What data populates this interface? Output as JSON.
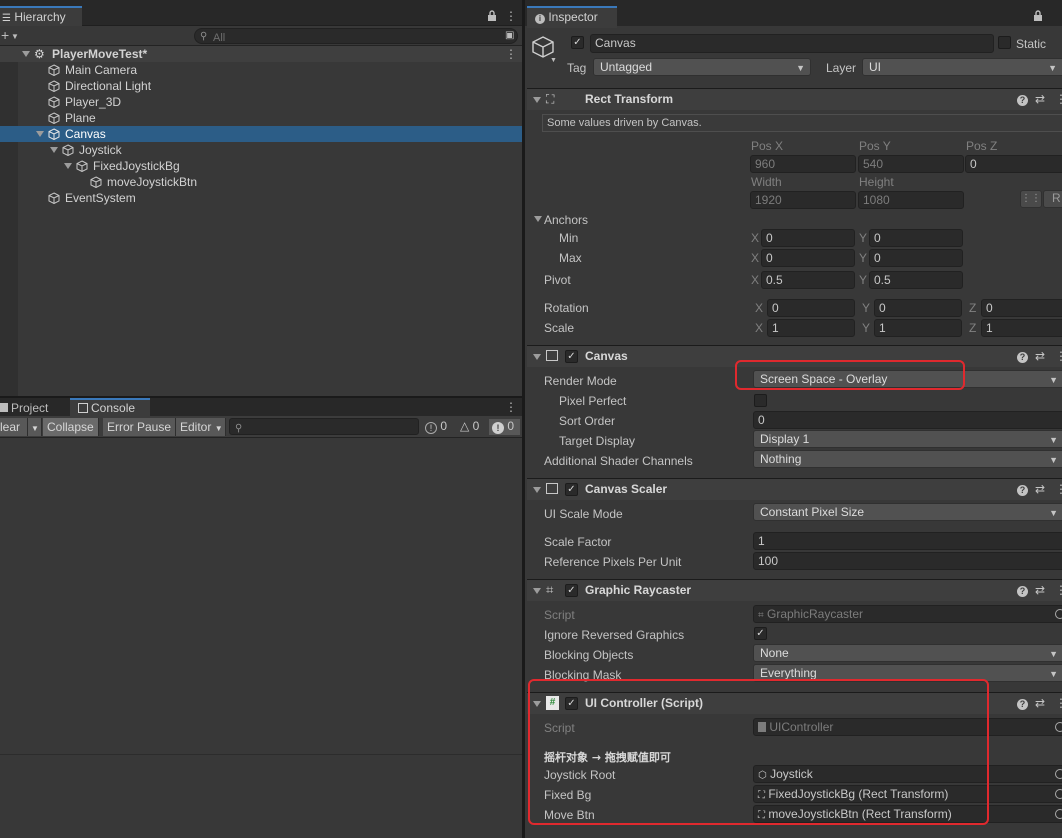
{
  "hierarchy": {
    "tab_label": "Hierarchy",
    "search_placeholder": "All",
    "scene_name": "PlayerMoveTest*",
    "items": [
      {
        "label": "Main Camera"
      },
      {
        "label": "Directional Light"
      },
      {
        "label": "Player_3D"
      },
      {
        "label": "Plane"
      },
      {
        "label": "Canvas"
      },
      {
        "label": "Joystick"
      },
      {
        "label": "FixedJoystickBg"
      },
      {
        "label": "moveJoystickBtn"
      },
      {
        "label": "EventSystem"
      }
    ]
  },
  "console": {
    "tabs": [
      {
        "label": "Project"
      },
      {
        "label": "Console"
      }
    ],
    "toolbar": {
      "clear_label": "lear",
      "collapse_label": "Collapse",
      "error_pause_label": "Error Pause",
      "editor_label": "Editor",
      "info_count": "0",
      "warning_count": "0",
      "error_count": "0"
    }
  },
  "inspector": {
    "tab_label": "Inspector",
    "object_name": "Canvas",
    "static_label": "Static",
    "tag_label": "Tag",
    "tag_value": "Untagged",
    "layer_label": "Layer",
    "layer_value": "UI",
    "rect_transform": {
      "title": "Rect Transform",
      "note": "Some values driven by Canvas.",
      "pos_x_label": "Pos X",
      "pos_y_label": "Pos Y",
      "pos_z_label": "Pos Z",
      "pos_x": "960",
      "pos_y": "540",
      "pos_z": "0",
      "width_label": "Width",
      "height_label": "Height",
      "width": "1920",
      "height": "1080",
      "r_label": "R",
      "anchors_label": "Anchors",
      "min_label": "Min",
      "max_label": "Max",
      "anchor_min_x": "0",
      "anchor_min_y": "0",
      "anchor_max_x": "0",
      "anchor_max_y": "0",
      "pivot_label": "Pivot",
      "pivot_x": "0.5",
      "pivot_y": "0.5",
      "rotation_label": "Rotation",
      "rot_x": "0",
      "rot_y": "0",
      "rot_z": "0",
      "scale_label": "Scale",
      "scale_x": "1",
      "scale_y": "1",
      "scale_z": "1",
      "x_label": "X",
      "y_label": "Y",
      "z_label": "Z"
    },
    "canvas": {
      "title": "Canvas",
      "render_mode_label": "Render Mode",
      "render_mode": "Screen Space - Overlay",
      "pixel_perfect_label": "Pixel Perfect",
      "sort_order_label": "Sort Order",
      "sort_order": "0",
      "target_display_label": "Target Display",
      "target_display": "Display 1",
      "shader_channels_label": "Additional Shader Channels",
      "shader_channels": "Nothing"
    },
    "canvas_scaler": {
      "title": "Canvas Scaler",
      "scale_mode_label": "UI Scale Mode",
      "scale_mode": "Constant Pixel Size",
      "scale_factor_label": "Scale Factor",
      "scale_factor": "1",
      "ref_pixels_label": "Reference Pixels Per Unit",
      "ref_pixels": "100"
    },
    "graphic_raycaster": {
      "title": "Graphic Raycaster",
      "script_label": "Script",
      "script_value": "GraphicRaycaster",
      "ignore_reversed_label": "Ignore Reversed Graphics",
      "blocking_objects_label": "Blocking Objects",
      "blocking_objects": "None",
      "blocking_mask_label": "Blocking Mask",
      "blocking_mask": "Everything"
    },
    "ui_controller": {
      "title": "UI Controller (Script)",
      "script_label": "Script",
      "script_value": "UIController",
      "section_header": "摇杆对象 → 拖拽赋值即可",
      "joystick_root_label": "Joystick Root",
      "joystick_root": "Joystick",
      "fixed_bg_label": "Fixed Bg",
      "fixed_bg": "FixedJoystickBg (Rect Transform)",
      "move_btn_label": "Move Btn",
      "move_btn": "moveJoystickBtn (Rect Transform)"
    }
  },
  "colors": {
    "selection": "#2c5d87",
    "highlight_box": "#e0292e",
    "tab_accent": "#3a79bb"
  }
}
